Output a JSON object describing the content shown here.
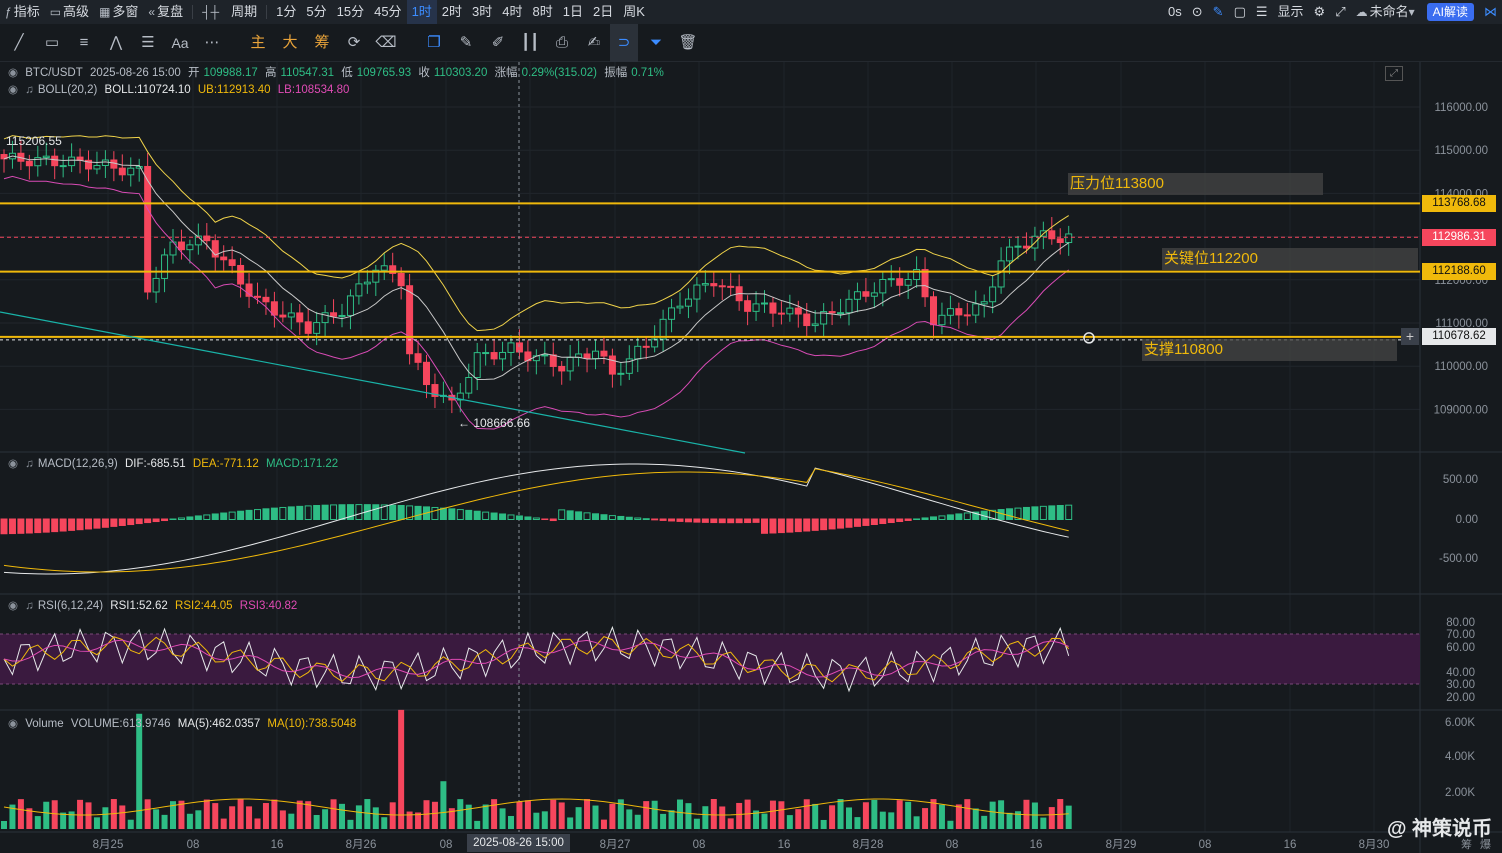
{
  "topbar": {
    "items": [
      {
        "label": "指标",
        "icon": "ƒ"
      },
      {
        "label": "高级",
        "icon": "▭"
      },
      {
        "label": "多窗",
        "icon": "▦"
      },
      {
        "label": "复盘",
        "icon": "«"
      },
      {
        "label": "",
        "icon": "┤┼"
      },
      {
        "label": "周期",
        "icon": ""
      },
      {
        "label": "1分"
      },
      {
        "label": "5分"
      },
      {
        "label": "15分"
      },
      {
        "label": "45分"
      },
      {
        "label": "1时",
        "active": true
      },
      {
        "label": "2时"
      },
      {
        "label": "3时"
      },
      {
        "label": "4时"
      },
      {
        "label": "8时"
      },
      {
        "label": "1日"
      },
      {
        "label": "2日"
      },
      {
        "label": "周K"
      }
    ],
    "right": {
      "latency": "0s",
      "display": "显示",
      "layout_name": "未命名",
      "ai_button": "AI解读"
    }
  },
  "toolbar": {
    "cn_tools": [
      "主",
      "大",
      "筹"
    ],
    "font_tool": "Aa"
  },
  "main_info": {
    "symbol": "BTC/USDT",
    "datetime": "2025-08-26 15:00",
    "open_label": "开",
    "open": "109988.17",
    "high_label": "高",
    "high": "110547.31",
    "low_label": "低",
    "low": "109765.93",
    "close_label": "收",
    "close": "110303.20",
    "change_label": "涨幅",
    "change": "0.29%(315.02)",
    "amp_label": "振幅",
    "amp": "0.71%"
  },
  "boll_info": {
    "name": "BOLL(20,2)",
    "boll": "BOLL:110724.10",
    "ub": "UB:112913.40",
    "lb": "LB:108534.80"
  },
  "macd_info": {
    "name": "MACD(12,26,9)",
    "dif": "DIF:-685.51",
    "dea": "DEA:-771.12",
    "macd": "MACD:171.22"
  },
  "rsi_info": {
    "name": "RSI(6,12,24)",
    "rsi1": "RSI1:52.62",
    "rsi2": "RSI2:44.05",
    "rsi3": "RSI3:40.82"
  },
  "vol_info": {
    "name": "Volume",
    "volume": "VOLUME:613.9746",
    "ma5": "MA(5):462.0357",
    "ma10": "MA(10):738.5048"
  },
  "price_axis": [
    "116000.00",
    "115000.00",
    "114000.00",
    "113000.00",
    "112000.00",
    "111000.00",
    "110000.00",
    "109000.00"
  ],
  "macd_axis": [
    "500.00",
    "0.00",
    "-500.00"
  ],
  "rsi_axis": [
    "80.00",
    "70.00",
    "60.00",
    "40.00",
    "30.00",
    "20.00"
  ],
  "vol_axis": [
    "6.00K",
    "4.00K",
    "2.00K"
  ],
  "time_axis": [
    "8月25",
    "08",
    "16",
    "8月26",
    "08",
    "8月27",
    "08",
    "16",
    "8月28",
    "08",
    "16",
    "8月29",
    "08",
    "16",
    "8月30"
  ],
  "crosshair_time": "2025-08-26 15:00",
  "price_tags": {
    "resist": "113768.68",
    "current": "112986.31",
    "key": "112188.60",
    "support": "110678.62"
  },
  "annotations": {
    "resist": "压力位113800",
    "key": "关键位112200",
    "support": "支撑110800"
  },
  "marks": {
    "high": "115206.55",
    "low": "← 108666.66"
  },
  "colors": {
    "up": "#2ebd85",
    "down": "#f6465d",
    "yellow": "#f0b90b",
    "accent": "#3c8cff"
  },
  "watermark": "@ 神策说币",
  "corner_labels": [
    "筹",
    "爆"
  ]
}
